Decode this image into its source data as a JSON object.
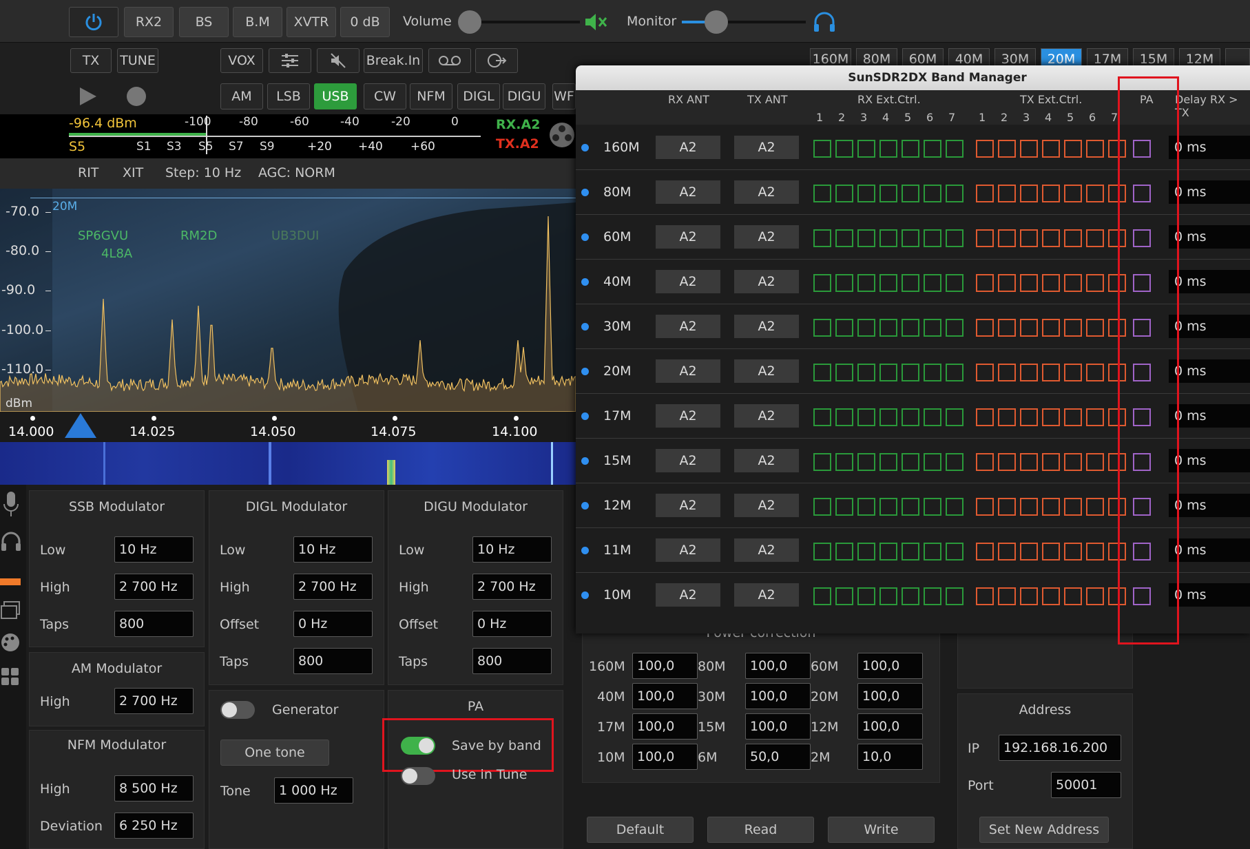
{
  "toolbar": {
    "rx2": "RX2",
    "bs": "BS",
    "bm": "B.M",
    "xvtr": "XVTR",
    "db": "0 dB",
    "volume": "Volume",
    "monitor": "Monitor"
  },
  "row2": {
    "tx": "TX",
    "tune": "TUNE",
    "vox": "VOX",
    "breakin": "Break.In"
  },
  "modes": [
    "AM",
    "LSB",
    "USB",
    "CW",
    "NFM",
    "DIGL",
    "DIGU",
    "WF"
  ],
  "active_mode": "USB",
  "smeter": {
    "dbm": "-96.4 dBm",
    "s": "S5",
    "top_scale": [
      "-100",
      "-80",
      "-60",
      "-40",
      "-20",
      "0"
    ],
    "bottom_scale": [
      "S1",
      "S3",
      "S5",
      "S7",
      "S9",
      "+20",
      "+40",
      "+60"
    ],
    "rx": "RX.A2",
    "tx": "TX.A2"
  },
  "status": {
    "rit": "RIT",
    "xit": "XIT",
    "step": "Step: 10 Hz",
    "agc": "AGC: NORM"
  },
  "spectrum": {
    "band": "20M",
    "dbm_unit": "dBm",
    "y_ticks": [
      "-70.0",
      "-80.0",
      "-90.0",
      "-100.0",
      "-110.0"
    ],
    "spots": [
      "SP6GVU",
      "4L8A",
      "RM2D",
      "UB3DUI"
    ],
    "freqs": [
      "14.000",
      "14.025",
      "14.050",
      "14.075",
      "14.100"
    ]
  },
  "ssb": {
    "title": "SSB Modulator",
    "low_label": "Low",
    "low": "10 Hz",
    "high_label": "High",
    "high": "2 700 Hz",
    "taps_label": "Taps",
    "taps": "800"
  },
  "am": {
    "title": "AM Modulator",
    "high_label": "High",
    "high": "2 700 Hz"
  },
  "nfm": {
    "title": "NFM Modulator",
    "high_label": "High",
    "high": "8 500 Hz",
    "dev_label": "Deviation",
    "dev": "6 250 Hz"
  },
  "digl": {
    "title": "DIGL Modulator",
    "low_label": "Low",
    "low": "10 Hz",
    "high_label": "High",
    "high": "2 700 Hz",
    "offset_label": "Offset",
    "offset": "0 Hz",
    "taps_label": "Taps",
    "taps": "800"
  },
  "digu": {
    "title": "DIGU Modulator",
    "low_label": "Low",
    "low": "10 Hz",
    "high_label": "High",
    "high": "2 700 Hz",
    "offset_label": "Offset",
    "offset": "0 Hz",
    "taps_label": "Taps",
    "taps": "800"
  },
  "generator": {
    "label": "Generator",
    "one_tone": "One tone",
    "tone_label": "Tone",
    "tone": "1 000 Hz"
  },
  "pa": {
    "title": "PA",
    "save_by_band": "Save by band",
    "use_in_tune": "Use in Tune"
  },
  "power": {
    "title": "Power correction",
    "items": [
      [
        "160M",
        "100,0"
      ],
      [
        "80M",
        "100,0"
      ],
      [
        "60M",
        "100,0"
      ],
      [
        "40M",
        "100,0"
      ],
      [
        "30M",
        "100,0"
      ],
      [
        "20M",
        "100,0"
      ],
      [
        "17M",
        "100,0"
      ],
      [
        "15M",
        "100,0"
      ],
      [
        "12M",
        "100,0"
      ],
      [
        "10M",
        "100,0"
      ],
      [
        "6M",
        "50,0"
      ],
      [
        "2M",
        "10,0"
      ]
    ],
    "default": "Default",
    "read": "Read",
    "write": "Write"
  },
  "address": {
    "title": "Address",
    "ip_label": "IP",
    "ip": "192.168.16.200",
    "port_label": "Port",
    "port": "50001",
    "set": "Set New Address"
  },
  "band_tabs": [
    "160M",
    "80M",
    "60M",
    "40M",
    "30M",
    "20M",
    "17M",
    "15M",
    "12M"
  ],
  "active_band": "20M",
  "band_manager": {
    "title": "SunSDR2DX Band Manager",
    "rx_ant": "RX ANT",
    "tx_ant": "TX ANT",
    "rx_ext": "RX Ext.Ctrl.",
    "tx_ext": "TX Ext.Ctrl.",
    "pa": "PA",
    "delay": "Delay RX > TX",
    "nums": [
      "1",
      "2",
      "3",
      "4",
      "5",
      "6",
      "7"
    ],
    "rows": [
      {
        "band": "160M",
        "rx": "A2",
        "tx": "A2",
        "delay": "0 ms"
      },
      {
        "band": "80M",
        "rx": "A2",
        "tx": "A2",
        "delay": "0 ms"
      },
      {
        "band": "60M",
        "rx": "A2",
        "tx": "A2",
        "delay": "0 ms"
      },
      {
        "band": "40M",
        "rx": "A2",
        "tx": "A2",
        "delay": "0 ms"
      },
      {
        "band": "30M",
        "rx": "A2",
        "tx": "A2",
        "delay": "0 ms"
      },
      {
        "band": "20M",
        "rx": "A2",
        "tx": "A2",
        "delay": "0 ms"
      },
      {
        "band": "17M",
        "rx": "A2",
        "tx": "A2",
        "delay": "0 ms"
      },
      {
        "band": "15M",
        "rx": "A2",
        "tx": "A2",
        "delay": "0 ms"
      },
      {
        "band": "12M",
        "rx": "A2",
        "tx": "A2",
        "delay": "0 ms"
      },
      {
        "band": "11M",
        "rx": "A2",
        "tx": "A2",
        "delay": "0 ms"
      },
      {
        "band": "10M",
        "rx": "A2",
        "tx": "A2",
        "delay": "0 ms"
      }
    ]
  }
}
